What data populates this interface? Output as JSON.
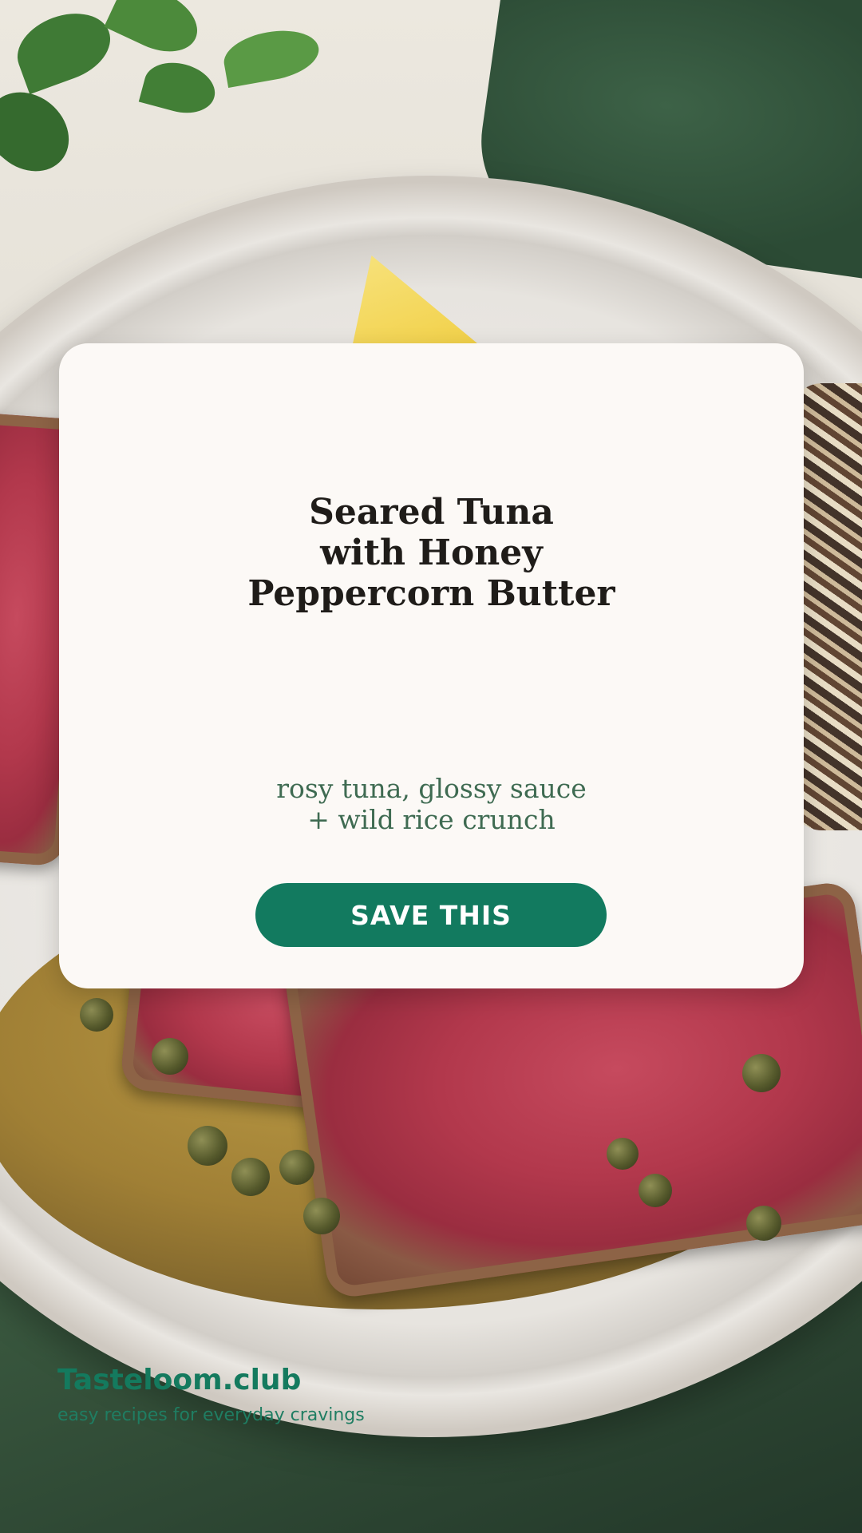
{
  "card": {
    "title": "Seared Tuna\nwith Honey\nPeppercorn Butter",
    "subtitle": "rosy tuna, glossy sauce\n+ wild rice crunch",
    "button_label": "SAVE THIS"
  },
  "brand": {
    "name": "Tasteloom.club",
    "tagline": "easy recipes for everyday cravings"
  },
  "colors": {
    "card_background": "#fcf9f6",
    "title": "#1f1c19",
    "subtitle": "#3f6b52",
    "button": "#127a5f",
    "brand": "#147a5e"
  }
}
